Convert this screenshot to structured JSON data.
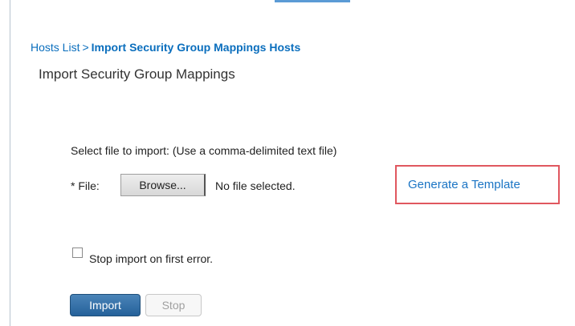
{
  "breadcrumb": {
    "parent": "Hosts List",
    "separator": ">",
    "current": "Import Security Group Mappings Hosts"
  },
  "page_title": "Import Security Group Mappings",
  "form": {
    "instructions": "Select file to import:  (Use a comma-delimited text file)",
    "file_label": "* File:",
    "browse_label": "Browse...",
    "file_status": "No file selected.",
    "template_link": "Generate a Template",
    "stop_on_error_label": "Stop import on first error.",
    "stop_on_error_checked": false,
    "import_label": "Import",
    "stop_label": "Stop"
  },
  "colors": {
    "link": "#0a6ebd",
    "highlight_box": "#e0575f",
    "primary_button": "#25619a",
    "tab_indicator": "#5b9bd5"
  }
}
